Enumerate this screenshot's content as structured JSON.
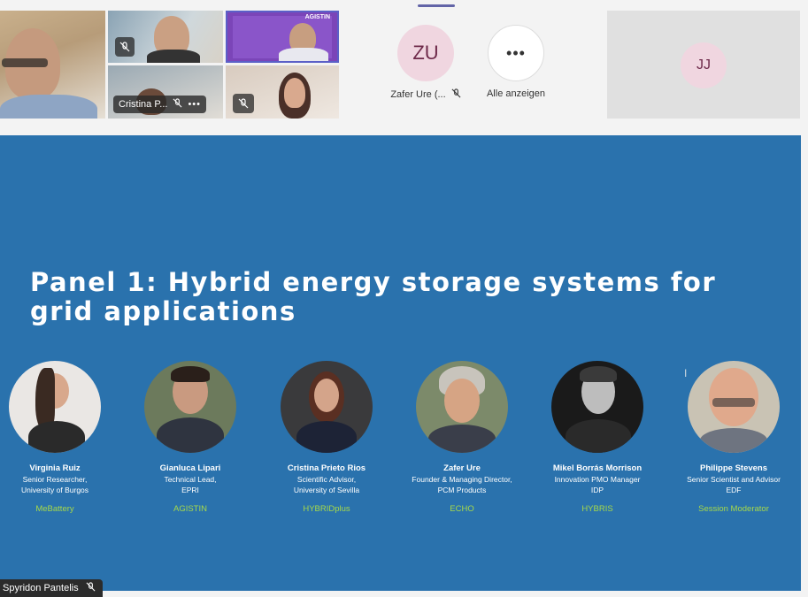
{
  "participants": {
    "video_tiles": [
      {
        "name": "",
        "muted": false
      },
      {
        "name": "",
        "muted": true
      },
      {
        "name": "",
        "muted": false,
        "logo": "AGISTIN"
      },
      {
        "name": "Cristina P...",
        "muted": true
      },
      {
        "name": "",
        "muted": true
      }
    ],
    "avatars": [
      {
        "initials": "ZU",
        "label": "Zafer Ure (...",
        "muted": true
      },
      {
        "initials": "•••",
        "label": "Alle anzeigen",
        "muted": false
      }
    ],
    "large_tile": {
      "initials": "JJ"
    }
  },
  "slide": {
    "title": "Panel 1: Hybrid energy storage systems for grid applications",
    "panelists": [
      {
        "name": "Virginia Ruiz",
        "role_lines": [
          "Senior Researcher,",
          "University of Burgos"
        ],
        "project": "MeBattery"
      },
      {
        "name": "Gianluca Lipari",
        "role_lines": [
          "Technical Lead,",
          "EPRI"
        ],
        "project": "AGISTIN"
      },
      {
        "name": "Cristina Prieto Rios",
        "role_lines": [
          "Scientific Advisor,",
          "University of Sevilla"
        ],
        "project": "HYBRIDplus"
      },
      {
        "name": "Zafer Ure",
        "role_lines": [
          "Founder & Managing Director,",
          "PCM Products"
        ],
        "project": "ECHO"
      },
      {
        "name": "Mikel Borrás Morrison",
        "role_lines": [
          "Innovation PMO Manager",
          "IDP"
        ],
        "project": "HYBRIS"
      },
      {
        "name": "Philippe Stevens",
        "role_lines": [
          "Senior Scientist and Advisor",
          "EDF"
        ],
        "project": "Session Moderator"
      }
    ]
  },
  "presenter": {
    "name": "Spyridon Pantelis",
    "muted": true
  },
  "colors": {
    "slide_bg": "#2a72ad",
    "project_label": "#a6d94a",
    "accent": "#6264a7"
  },
  "icons": {
    "mic_off": "mic-off-icon",
    "more": "more-options-icon"
  }
}
